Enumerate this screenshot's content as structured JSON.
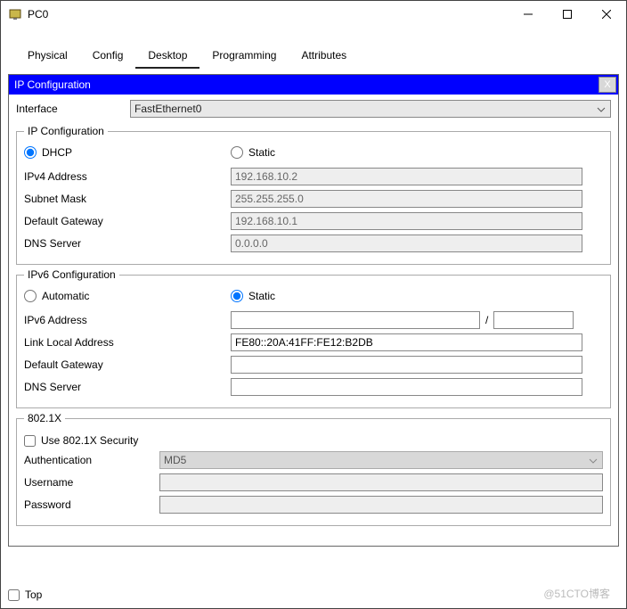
{
  "window": {
    "title": "PC0"
  },
  "tabs": {
    "physical": "Physical",
    "config": "Config",
    "desktop": "Desktop",
    "programming": "Programming",
    "attributes": "Attributes"
  },
  "card": {
    "title": "IP Configuration",
    "close": "X",
    "iface_label": "Interface",
    "iface_value": "FastEthernet0"
  },
  "ipcfg": {
    "legend": "IP Configuration",
    "dhcp": "DHCP",
    "static": "Static",
    "ipv4_label": "IPv4 Address",
    "ipv4_value": "192.168.10.2",
    "mask_label": "Subnet Mask",
    "mask_value": "255.255.255.0",
    "gw_label": "Default Gateway",
    "gw_value": "192.168.10.1",
    "dns_label": "DNS Server",
    "dns_value": "0.0.0.0"
  },
  "ipv6": {
    "legend": "IPv6 Configuration",
    "auto": "Automatic",
    "static": "Static",
    "addr_label": "IPv6 Address",
    "addr_value": "",
    "prefix_value": "",
    "ll_label": "Link Local Address",
    "ll_value": "FE80::20A:41FF:FE12:B2DB",
    "gw_label": "Default Gateway",
    "gw_value": "",
    "dns_label": "DNS Server",
    "dns_value": ""
  },
  "dot1x": {
    "legend": "802.1X",
    "use_label": "Use 802.1X Security",
    "auth_label": "Authentication",
    "auth_value": "MD5",
    "user_label": "Username",
    "user_value": "",
    "pass_label": "Password",
    "pass_value": ""
  },
  "bottom": {
    "top": "Top"
  },
  "watermark": "@51CTO博客"
}
